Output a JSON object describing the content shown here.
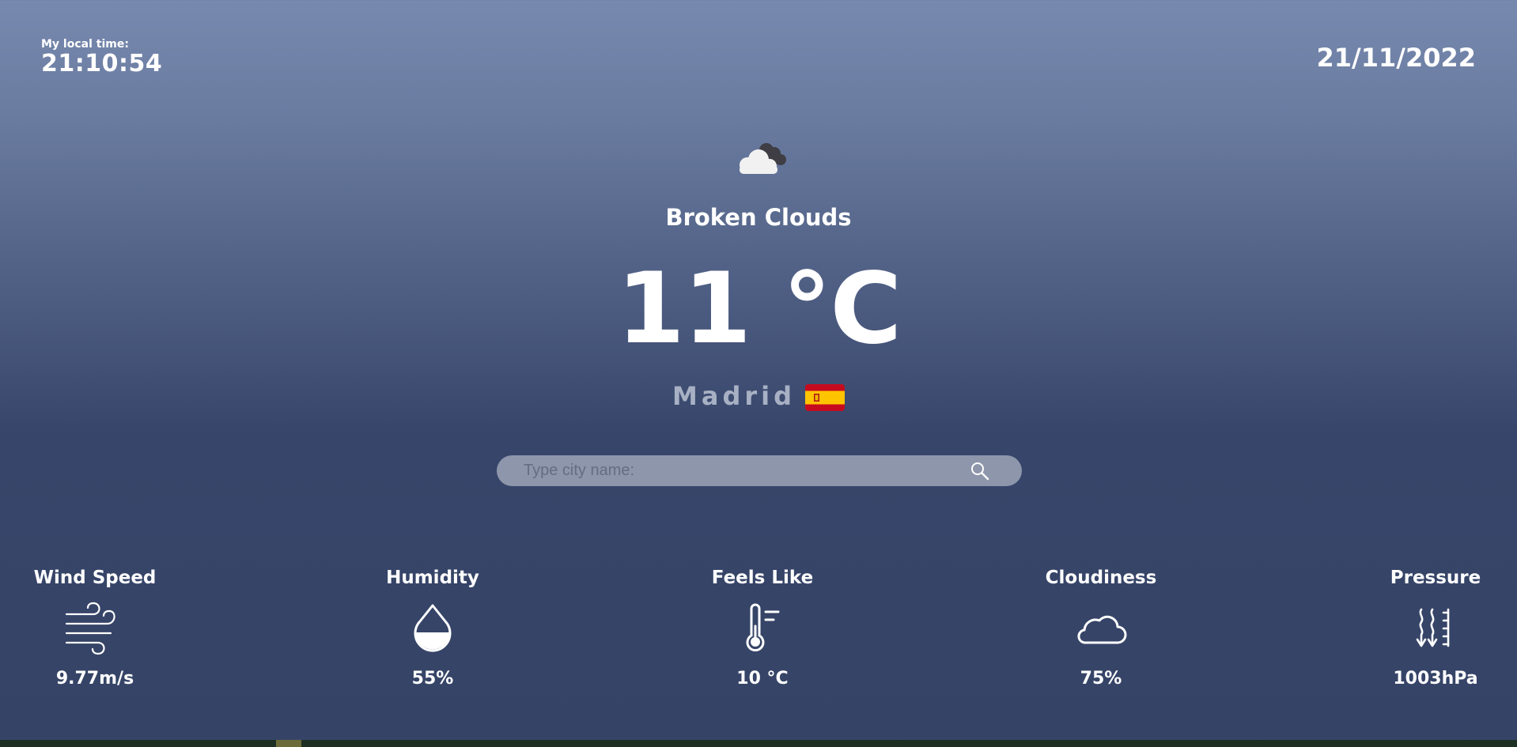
{
  "local_time": {
    "label": "My local time:",
    "value": "21:10:54"
  },
  "date": "21/11/2022",
  "weather": {
    "icon": "broken-clouds-icon",
    "description": "Broken Clouds",
    "temperature": "11 °C",
    "city": "Madrid",
    "flag": "spain-flag-icon"
  },
  "search": {
    "placeholder": "Type city name:",
    "value": "",
    "icon": "search-icon"
  },
  "metrics": [
    {
      "title": "Wind Speed",
      "icon": "wind-icon",
      "value": "9.77m/s"
    },
    {
      "title": "Humidity",
      "icon": "humidity-drop-icon",
      "value": "55%"
    },
    {
      "title": "Feels Like",
      "icon": "thermometer-icon",
      "value": "10 °C"
    },
    {
      "title": "Cloudiness",
      "icon": "cloud-icon",
      "value": "75%"
    },
    {
      "title": "Pressure",
      "icon": "pressure-icon",
      "value": "1003hPa"
    }
  ],
  "colors": {
    "background_top": "#7789ae",
    "background_bottom": "#354466",
    "search_bar": "#8e96ab",
    "city_text": "#a8b0c4"
  }
}
